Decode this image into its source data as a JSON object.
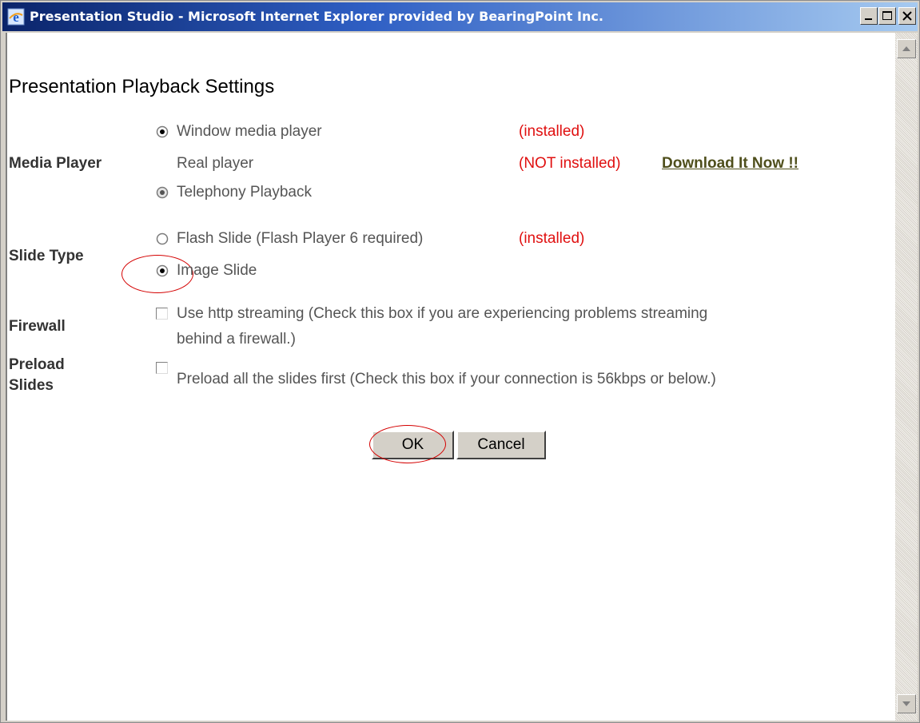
{
  "window": {
    "title": "Presentation Studio - Microsoft Internet Explorer provided by BearingPoint Inc."
  },
  "page": {
    "title": "Presentation Playback Settings"
  },
  "media_player": {
    "label": "Media Player",
    "options": [
      {
        "label": "Window media player",
        "status": "(installed)",
        "selected": true
      },
      {
        "label": "Real player",
        "status": "(NOT installed)",
        "link": "Download It Now !!"
      },
      {
        "label": "Telephony Playback",
        "selected": false
      }
    ]
  },
  "slide_type": {
    "label": "Slide Type",
    "options": [
      {
        "label": "Flash Slide (Flash Player 6 required)",
        "status": "(installed)",
        "selected": false
      },
      {
        "label": "Image Slide",
        "selected": true
      }
    ]
  },
  "firewall": {
    "label": "Firewall",
    "checkbox_text_line1": "Use http streaming (Check this box if you are experiencing problems streaming",
    "checkbox_text_line2": "behind a firewall.)",
    "checked": false
  },
  "preload": {
    "label_line1": "Preload",
    "label_line2": "Slides",
    "checkbox_text": "Preload all the slides first (Check this box if your connection is 56kbps or below.)",
    "checked": false
  },
  "buttons": {
    "ok": "OK",
    "cancel": "Cancel"
  },
  "colors": {
    "status_red": "#e01010",
    "link": "#4f4f1c",
    "highlight": "#d40000",
    "titlebar": "#0a246a"
  },
  "icons": {
    "app": "ie-icon",
    "minimize": "minimize-icon",
    "maximize": "maximize-icon",
    "close": "close-icon"
  }
}
